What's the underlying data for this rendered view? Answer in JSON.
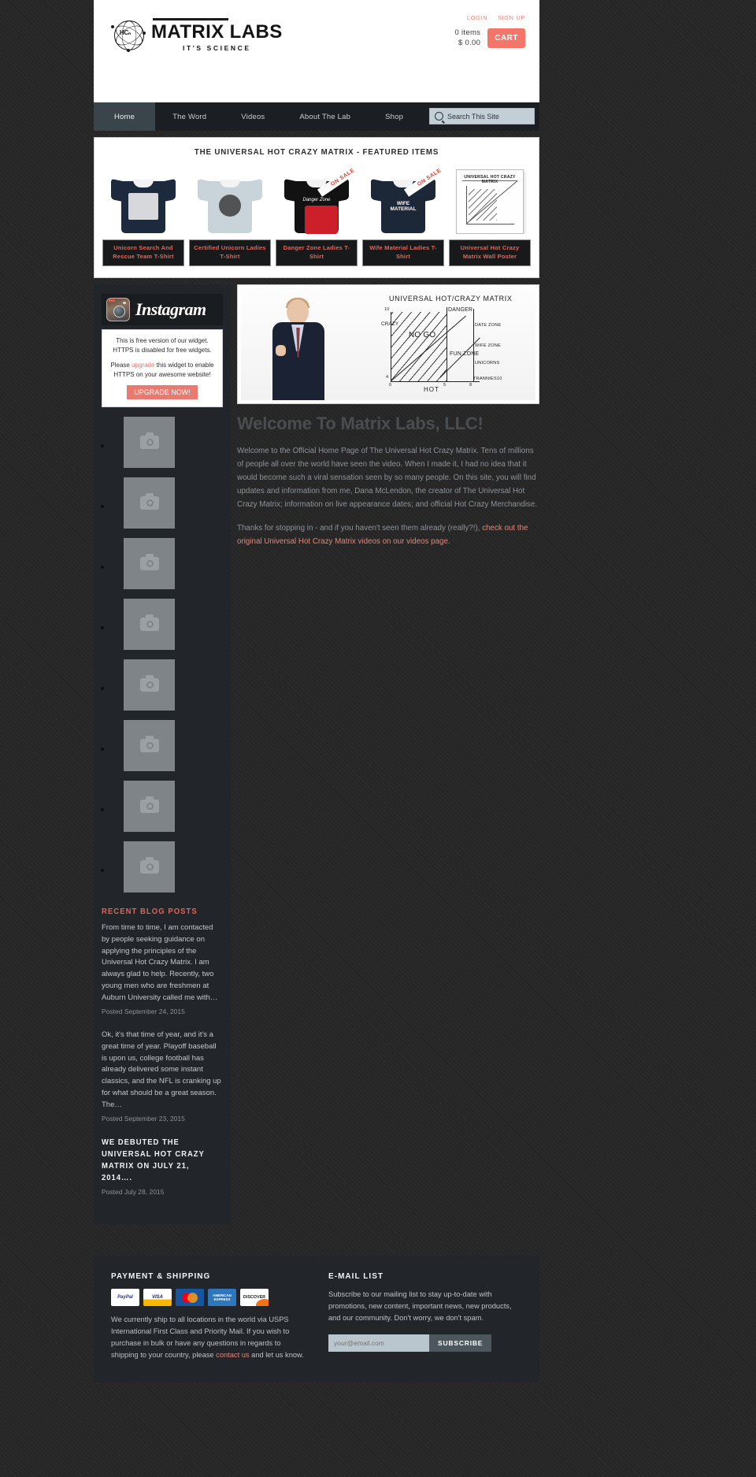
{
  "header": {
    "logo": {
      "mark": "HCₙ",
      "title": "MATRIX LABS",
      "tagline": "IT'S SCIENCE"
    },
    "account": {
      "login": "LOGIN",
      "signup": "SIGN UP"
    },
    "cart": {
      "items": "0 items",
      "total": "$ 0.00",
      "button": "CART"
    }
  },
  "nav": {
    "items": [
      {
        "label": "Home",
        "active": true
      },
      {
        "label": "The Word",
        "active": false
      },
      {
        "label": "Videos",
        "active": false
      },
      {
        "label": "About The Lab",
        "active": false
      },
      {
        "label": "Shop",
        "active": false
      }
    ],
    "search_placeholder": "Search This Site"
  },
  "featured": {
    "title": "THE UNIVERSAL HOT CRAZY MATRIX - FEATURED ITEMS",
    "sale_badge": "ON SALE",
    "products": [
      {
        "name": "Unicorn Search And Rescue Team T-Shirt",
        "on_sale": false,
        "color": "#1d2a3d",
        "art": "crest"
      },
      {
        "name": "Certified Unicorn Ladies T-Shirt",
        "on_sale": false,
        "color": "#c9d3da",
        "art": "circle"
      },
      {
        "name": "Danger Zone Ladies T-Shirt",
        "on_sale": true,
        "color": "#121212",
        "art": "script"
      },
      {
        "name": "Wife Material Ladies T-Shirt",
        "on_sale": true,
        "color": "#1c2737",
        "art": "wife"
      },
      {
        "name": "Universal Hot Crazy Matrix Wall Poster",
        "on_sale": false,
        "color": "#ffffff",
        "art": "poster"
      }
    ],
    "poster_heading": "UNIVERSAL HOT CRAZY MATRIX"
  },
  "sidebar": {
    "instagram": {
      "wordmark": "Instagram",
      "line1": "This is free version of our widget. HTTPS is disabled for free widgets.",
      "line2_pre": "Please ",
      "line2_link": "upgrade",
      "line2_post": " this widget to enable HTTPS on your awesome website!",
      "upgrade_button": "UPGRADE NOW!",
      "photo_count": 8
    },
    "blog": {
      "heading": "RECENT BLOG POSTS",
      "posts": [
        {
          "excerpt": "From time to time, I am contacted by people seeking guidance on applying the principles of the Universal Hot Crazy Matrix. I am always glad to help. Recently, two young men who are freshmen at Auburn University called me with…",
          "date": "Posted September 24, 2015",
          "is_title": false
        },
        {
          "excerpt": "Ok, it's that time of year, and it's a great time of year. Playoff baseball is upon us, college football has already delivered some instant classics, and the NFL is cranking up for what should be a great season. The…",
          "date": "Posted September 23, 2015",
          "is_title": false
        },
        {
          "excerpt": "WE DEBUTED THE UNIVERSAL HOT CRAZY MATRIX ON JULY 21, 2014….",
          "date": "Posted July 28, 2015",
          "is_title": true
        }
      ]
    }
  },
  "hero": {
    "whiteboard": {
      "title": "UNIVERSAL HOT/CRAZY MATRIX",
      "y_axis": "CRAZY",
      "x_axis": "HOT",
      "y_ticks": [
        "10",
        "4"
      ],
      "x_ticks": [
        "0",
        "5",
        "8",
        "10"
      ],
      "zones": [
        {
          "label": "NO GO"
        },
        {
          "label": "FUN ZONE"
        },
        {
          "label": "DANGER"
        },
        {
          "label": "DATE ZONE"
        },
        {
          "label": "WIFE ZONE"
        },
        {
          "label": "UNICORNS"
        },
        {
          "label": "TRANNIES"
        }
      ]
    }
  },
  "main": {
    "title": "Welcome To Matrix Labs, LLC!",
    "paragraph1": "Welcome to the Official Home Page of The Universal Hot Crazy Matrix.  Tens of millions of people all over the world have seen the video.  When I made it, I had no idea that it would become such a viral sensation seen by so many people.  On this site, you will find updates and information from me, Dana McLendon, the creator of The Universal Hot Crazy Matrix; information on live appearance dates; and official Hot Crazy Merchandise.",
    "paragraph2_pre": "Thanks for stopping in - and if you haven't seen them already (really?!), ",
    "paragraph2_link": "check out the original Universal Hot Crazy Matrix videos on our videos page."
  },
  "footer": {
    "payment": {
      "heading": "PAYMENT & SHIPPING",
      "methods": [
        "PayPal",
        "VISA",
        "MasterCard",
        "AMERICAN EXPRESS",
        "DISCOVER"
      ],
      "text_pre": "We currently ship to all locations in the world via USPS International First Class and Priority Mail. If you wish to purchase in bulk or have any questions in regards to shipping to your country, please ",
      "text_link": "contact us",
      "text_post": " and let us know."
    },
    "email": {
      "heading": "E-MAIL LIST",
      "text": "Subscribe to our mailing list to stay up-to-date with promotions, new content, important news, new products, and our community. Don't worry, we don't spam.",
      "input_placeholder": "your@email.com",
      "button": "SUBSCRIBE"
    }
  },
  "colors": {
    "accent": "#e0675c",
    "cart": "#f4766a",
    "dark": "#22262a",
    "nav": "#1b1f23"
  }
}
